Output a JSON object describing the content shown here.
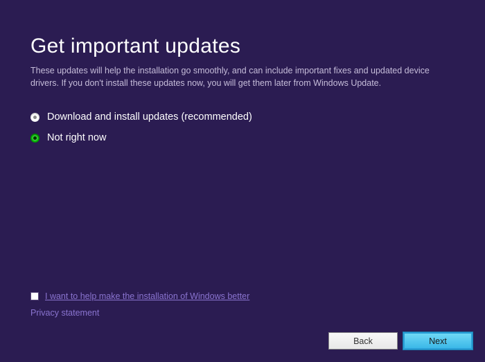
{
  "header": {
    "title": "Get important updates",
    "description": "These updates will help the installation go smoothly, and can include important fixes and updated device drivers. If you don't install these updates now, you will get them later from Windows Update."
  },
  "options": {
    "download": "Download and install updates (recommended)",
    "later": "Not right now"
  },
  "footer": {
    "help_checkbox_label": "I want to help make the installation of Windows better",
    "privacy_link": "Privacy statement"
  },
  "buttons": {
    "back": "Back",
    "next": "Next"
  }
}
